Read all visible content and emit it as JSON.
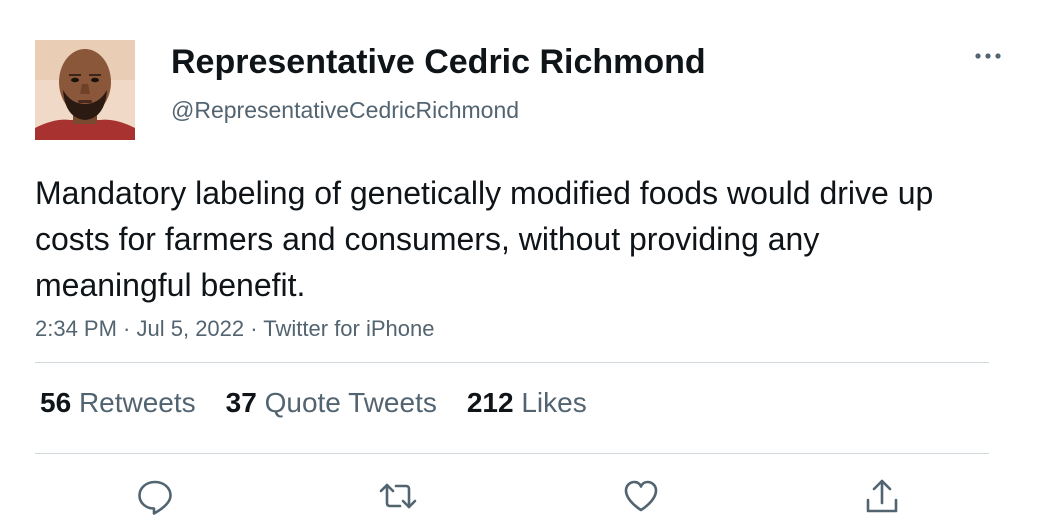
{
  "author": {
    "display_name": "Representative Cedric Richmond",
    "handle": "@RepresentativeCedricRichmond",
    "avatar_icon": "profile-photo"
  },
  "tweet": {
    "text": "Mandatory labeling of genetically modified foods would drive up costs for farmers and consumers, without providing any meaningful benefit.",
    "time": "2:34 PM",
    "date": "Jul 5, 2022",
    "source": "Twitter for iPhone",
    "separator": " · "
  },
  "stats": {
    "retweets": {
      "count": "56",
      "label": "Retweets"
    },
    "quote_tweets": {
      "count": "37",
      "label": "Quote Tweets"
    },
    "likes": {
      "count": "212",
      "label": "Likes"
    }
  },
  "actions": {
    "reply_icon": "reply-icon",
    "retweet_icon": "retweet-icon",
    "like_icon": "heart-icon",
    "share_icon": "share-icon"
  },
  "colors": {
    "text_primary": "#0f1419",
    "text_secondary": "#536471",
    "divider": "#cfd9de"
  }
}
